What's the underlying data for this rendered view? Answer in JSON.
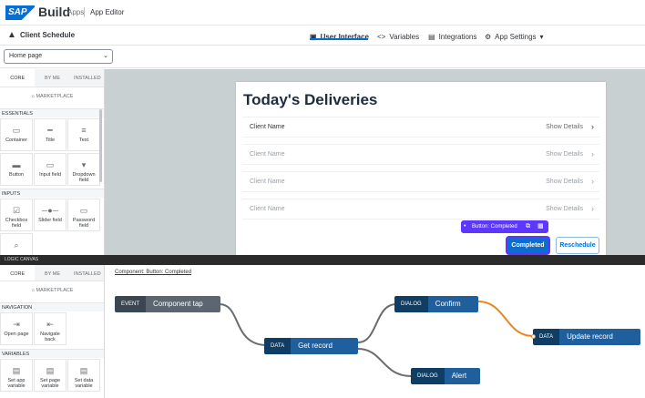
{
  "header": {
    "logo": "SAP",
    "product": "Build",
    "apps_link": "Apps",
    "section": "App Editor"
  },
  "subheader": {
    "project": "Client Schedule",
    "tabs": [
      {
        "label": "User Interface",
        "icon": "layout-icon",
        "active": true
      },
      {
        "label": "Variables",
        "icon": "code-icon"
      },
      {
        "label": "Integrations",
        "icon": "database-icon"
      },
      {
        "label": "App Settings",
        "icon": "gear-icon"
      }
    ]
  },
  "page_select": {
    "value": "Home page"
  },
  "component_panel": {
    "tabs": [
      "CORE",
      "BY ME",
      "INSTALLED"
    ],
    "marketplace": "MARKETPLACE",
    "sections": [
      {
        "title": "ESSENTIALS",
        "items": [
          "Container",
          "Title",
          "Text",
          "Button",
          "Input field",
          "Dropdown field"
        ]
      },
      {
        "title": "INPUTS",
        "items": [
          "Checkbox field",
          "Slider field",
          "Password field"
        ]
      }
    ]
  },
  "screen": {
    "title": "Today's Deliveries",
    "rows": [
      {
        "client": "Client Name",
        "action": "Show Details"
      },
      {
        "client": "Client Name",
        "action": "Show Details"
      },
      {
        "client": "Client Name",
        "action": "Show Details"
      },
      {
        "client": "Client Name",
        "action": "Show Details"
      }
    ],
    "selection_label": "Button: Completed",
    "primary_button": "Completed",
    "secondary_button": "Reschedule"
  },
  "logic_canvas": {
    "bar_label": "LOGIC CANVAS",
    "breadcrumb": "Component: Button: Completed",
    "panel_tabs": [
      "CORE",
      "BY ME",
      "INSTALLED"
    ],
    "marketplace": "MARKETPLACE",
    "sections": [
      {
        "title": "NAVIGATION",
        "items": [
          "Open page",
          "Navigate back"
        ]
      },
      {
        "title": "VARIABLES",
        "items": [
          "Set app variable",
          "Set page variable",
          "Set data variable"
        ]
      }
    ],
    "nodes": [
      {
        "kind": "EVENT",
        "name": "Component tap"
      },
      {
        "kind": "DATA",
        "name": "Get record"
      },
      {
        "kind": "DIALOG",
        "name": "Confirm"
      },
      {
        "kind": "DIALOG",
        "name": "Alert"
      },
      {
        "kind": "DATA",
        "name": "Update record"
      }
    ]
  },
  "colors": {
    "accent": "#0a6ed1",
    "selection": "#5d36ff",
    "node_dark": "#0f3d63",
    "node": "#1f5f9e",
    "confirm_wire": "#e8871e"
  }
}
